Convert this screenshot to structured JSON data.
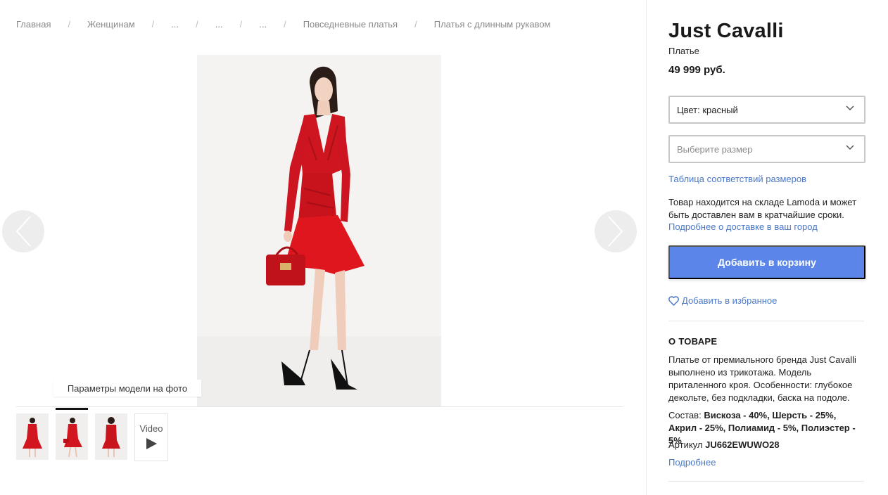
{
  "breadcrumb": {
    "separator": "/",
    "items": [
      "Главная",
      "Женщинам",
      "...",
      "...",
      "...",
      "Повседневные платья",
      "Платья с длинным рукавом"
    ]
  },
  "gallery": {
    "model_params_label": "Параметры модели на фото",
    "prev_icon": "chevron-left-icon",
    "next_icon": "chevron-right-icon",
    "thumbnails_count": 3,
    "active_thumbnail": 2,
    "video_label": "Video"
  },
  "product": {
    "brand": "Just Cavalli",
    "type": "Платье",
    "price": "49 999 руб.",
    "color_select": "Цвет: красный",
    "size_select_placeholder": "Выберите размер",
    "size_table_link": "Таблица соответствий размеров",
    "stock_text": "Товар находится на складе Lamoda и может быть доставлен вам в кратчайшие сроки.",
    "delivery_link": "Подробнее о доставке в ваш город",
    "add_to_cart": "Добавить в корзину",
    "add_to_favorites": "Добавить в избранное"
  },
  "about": {
    "title": "О ТОВАРЕ",
    "description": "Платье от премиального бренда Just Cavalli выполнено из трикотажа. Модель приталенного кроя. Особенности: глубокое декольте, без подкладки, баска на подоле.",
    "composition_label": "Состав:",
    "composition_value": "Вискоза - 40%, Шерсть - 25%, Акрил - 25%, Полиамид - 5%, Полиэстер - 5%",
    "article_label": "Артикул",
    "article_value": "JU662EWUWO28",
    "more_link": "Подробнее"
  },
  "colors": {
    "accent_blue": "#5b85e8",
    "link_blue": "#4a78c8",
    "dress_red": "#d8141c"
  }
}
